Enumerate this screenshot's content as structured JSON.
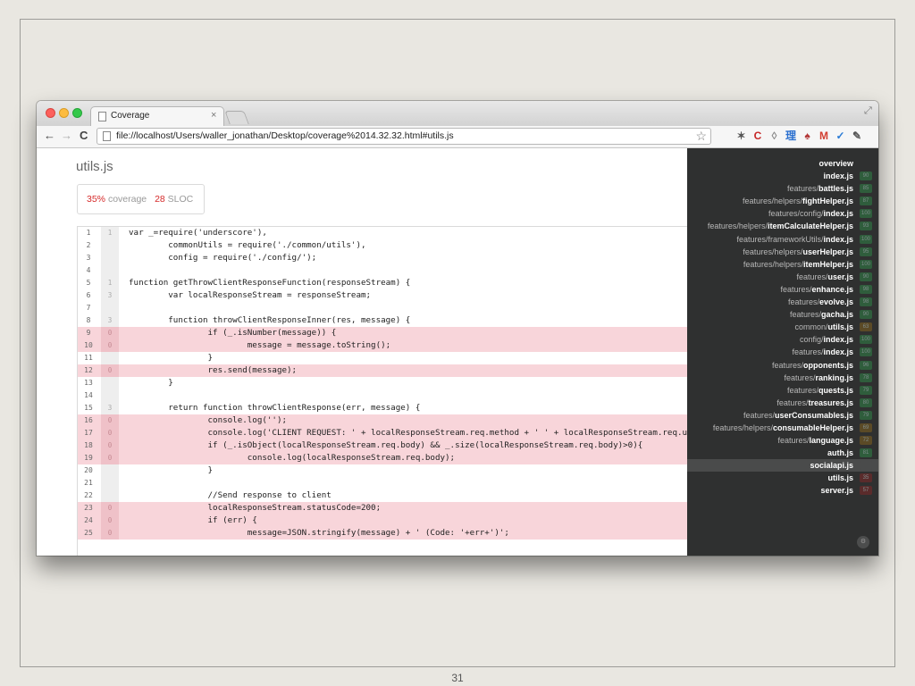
{
  "page_number": "31",
  "browser": {
    "tab_title": "Coverage",
    "tab_close": "×",
    "url": "file://localhost/Users/waller_jonathan/Desktop/coverage%2014.32.32.html#utils.js",
    "nav": {
      "back": "←",
      "forward": "→",
      "reload": "C"
    },
    "star": "☆",
    "extensions": [
      {
        "name": "wand-icon",
        "glyph": "✶",
        "color": "#555555"
      },
      {
        "name": "c-extension-icon",
        "glyph": "C",
        "color": "#c62828"
      },
      {
        "name": "shield-icon",
        "glyph": "◊",
        "color": "#8a8a8a"
      },
      {
        "name": "kanji-icon",
        "glyph": "理",
        "color": "#2a6fcf"
      },
      {
        "name": "flame-icon",
        "glyph": "♠",
        "color": "#b33838"
      },
      {
        "name": "gmail-icon",
        "glyph": "M",
        "color": "#d23f31"
      },
      {
        "name": "check-icon",
        "glyph": "✓",
        "color": "#2a7bd6"
      },
      {
        "name": "wrench-icon",
        "glyph": "✎",
        "color": "#555555"
      }
    ]
  },
  "report": {
    "file_title": "utils.js",
    "coverage_pct": "35%",
    "coverage_label": "coverage",
    "sloc_count": "28",
    "sloc_label": "SLOC"
  },
  "code_lines": [
    {
      "n": "1",
      "hits": "1",
      "miss": false,
      "code": "var _=require('underscore'),"
    },
    {
      "n": "2",
      "hits": "",
      "miss": false,
      "code": "        commonUtils = require('./common/utils'),"
    },
    {
      "n": "3",
      "hits": "",
      "miss": false,
      "code": "        config = require('./config/');"
    },
    {
      "n": "4",
      "hits": "",
      "miss": false,
      "code": ""
    },
    {
      "n": "5",
      "hits": "1",
      "miss": false,
      "code": "function getThrowClientResponseFunction(responseStream) {"
    },
    {
      "n": "6",
      "hits": "3",
      "miss": false,
      "code": "        var localResponseStream = responseStream;"
    },
    {
      "n": "7",
      "hits": "",
      "miss": false,
      "code": ""
    },
    {
      "n": "8",
      "hits": "3",
      "miss": false,
      "code": "        function throwClientResponseInner(res, message) {"
    },
    {
      "n": "9",
      "hits": "0",
      "miss": true,
      "code": "                if (_.isNumber(message)) {"
    },
    {
      "n": "10",
      "hits": "0",
      "miss": true,
      "code": "                        message = message.toString();"
    },
    {
      "n": "11",
      "hits": "",
      "miss": false,
      "code": "                }"
    },
    {
      "n": "12",
      "hits": "0",
      "miss": true,
      "code": "                res.send(message);"
    },
    {
      "n": "13",
      "hits": "",
      "miss": false,
      "code": "        }"
    },
    {
      "n": "14",
      "hits": "",
      "miss": false,
      "code": ""
    },
    {
      "n": "15",
      "hits": "3",
      "miss": false,
      "code": "        return function throwClientResponse(err, message) {"
    },
    {
      "n": "16",
      "hits": "0",
      "miss": true,
      "code": "                console.log('');"
    },
    {
      "n": "17",
      "hits": "0",
      "miss": true,
      "code": "                console.log('CLIENT REQUEST: ' + localResponseStream.req.method + ' ' + localResponseStream.req.url);"
    },
    {
      "n": "18",
      "hits": "0",
      "miss": true,
      "code": "                if (_.isObject(localResponseStream.req.body) && _.size(localResponseStream.req.body)>0){"
    },
    {
      "n": "19",
      "hits": "0",
      "miss": true,
      "code": "                        console.log(localResponseStream.req.body);"
    },
    {
      "n": "20",
      "hits": "",
      "miss": false,
      "code": "                }"
    },
    {
      "n": "21",
      "hits": "",
      "miss": false,
      "code": ""
    },
    {
      "n": "22",
      "hits": "",
      "miss": false,
      "code": "                //Send response to client"
    },
    {
      "n": "23",
      "hits": "0",
      "miss": true,
      "code": "                localResponseStream.statusCode=200;"
    },
    {
      "n": "24",
      "hits": "0",
      "miss": true,
      "code": "                if (err) {"
    },
    {
      "n": "25",
      "hits": "0",
      "miss": true,
      "code": "                        message=JSON.stringify(message) + ' (Code: '+err+')';"
    }
  ],
  "sidebar": {
    "title": "overview",
    "footer_icon": "⚙",
    "items": [
      {
        "prefix": "",
        "file": "index.js",
        "pct": "90",
        "color": "#2f5d3c",
        "active": false
      },
      {
        "prefix": "features/",
        "file": "battles.js",
        "pct": "85",
        "color": "#2f5d3c",
        "active": false
      },
      {
        "prefix": "features/helpers/",
        "file": "fightHelper.js",
        "pct": "87",
        "color": "#2f5d3c",
        "active": false
      },
      {
        "prefix": "features/config/",
        "file": "index.js",
        "pct": "100",
        "color": "#2f5d3c",
        "active": false
      },
      {
        "prefix": "features/helpers/",
        "file": "itemCalculateHelper.js",
        "pct": "93",
        "color": "#2f5d3c",
        "active": false
      },
      {
        "prefix": "features/frameworkUtils/",
        "file": "index.js",
        "pct": "100",
        "color": "#2f5d3c",
        "active": false
      },
      {
        "prefix": "features/helpers/",
        "file": "userHelper.js",
        "pct": "95",
        "color": "#2f5d3c",
        "active": false
      },
      {
        "prefix": "features/helpers/",
        "file": "itemHelper.js",
        "pct": "100",
        "color": "#2f5d3c",
        "active": false
      },
      {
        "prefix": "features/",
        "file": "user.js",
        "pct": "90",
        "color": "#2f5d3c",
        "active": false
      },
      {
        "prefix": "features/",
        "file": "enhance.js",
        "pct": "98",
        "color": "#2f5d3c",
        "active": false
      },
      {
        "prefix": "features/",
        "file": "evolve.js",
        "pct": "98",
        "color": "#2f5d3c",
        "active": false
      },
      {
        "prefix": "features/",
        "file": "gacha.js",
        "pct": "90",
        "color": "#2f5d3c",
        "active": false
      },
      {
        "prefix": "common/",
        "file": "utils.js",
        "pct": "63",
        "color": "#5b4a26",
        "active": false
      },
      {
        "prefix": "config/",
        "file": "index.js",
        "pct": "100",
        "color": "#2f5d3c",
        "active": false
      },
      {
        "prefix": "features/",
        "file": "index.js",
        "pct": "100",
        "color": "#2f5d3c",
        "active": false
      },
      {
        "prefix": "features/",
        "file": "opponents.js",
        "pct": "96",
        "color": "#2f5d3c",
        "active": false
      },
      {
        "prefix": "features/",
        "file": "ranking.js",
        "pct": "78",
        "color": "#2f5d3c",
        "active": false
      },
      {
        "prefix": "features/",
        "file": "quests.js",
        "pct": "79",
        "color": "#2f5d3c",
        "active": false
      },
      {
        "prefix": "features/",
        "file": "treasures.js",
        "pct": "80",
        "color": "#2f5d3c",
        "active": false
      },
      {
        "prefix": "features/",
        "file": "userConsumables.js",
        "pct": "79",
        "color": "#2f5d3c",
        "active": false
      },
      {
        "prefix": "features/helpers/",
        "file": "consumableHelper.js",
        "pct": "69",
        "color": "#5b4a26",
        "active": false
      },
      {
        "prefix": "features/",
        "file": "language.js",
        "pct": "72",
        "color": "#5b4a26",
        "active": false
      },
      {
        "prefix": "",
        "file": "auth.js",
        "pct": "81",
        "color": "#2f5d3c",
        "active": false
      },
      {
        "prefix": "",
        "file": "socialapi.js",
        "pct": "",
        "color": "#4a4b4b",
        "active": true
      },
      {
        "prefix": "",
        "file": "utils.js",
        "pct": "35",
        "color": "#5a2b2b",
        "active": false
      },
      {
        "prefix": "",
        "file": "server.js",
        "pct": "57",
        "color": "#5a2b2b",
        "active": false
      }
    ]
  }
}
